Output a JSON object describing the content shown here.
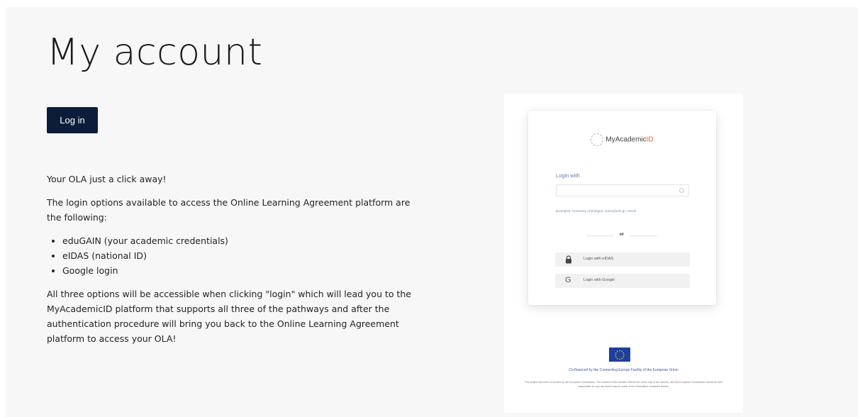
{
  "page": {
    "title": "My account",
    "login_button": "Log in"
  },
  "content": {
    "intro": "Your OLA just a click away!",
    "options_text": "The login options available to access the Online Learning Agreement platform are the following:",
    "options": [
      "eduGAIN (your academic credentials)",
      "eIDAS (national ID)",
      "Google login"
    ],
    "closing": "All three options will be accessible when clicking \"login\" which will lead you to the MyAcademicID platform that supports all three of the pathways and after the authentication procedure will bring you back to the Online Learning Agreement platform to access your OLA!"
  },
  "preview": {
    "brand_prefix": "My",
    "brand_main": "Academic",
    "brand_suffix": "ID",
    "login_with": "Login with",
    "example": "Examples: University of Bologna; name@edu.gr; Umich",
    "or": "or",
    "eidas_label": "Login with eIDAS",
    "google_label": "Login with Google",
    "eu_caption": "Co-financed by the Connecting Europe Facility of the European Union",
    "eu_disclaimer": "This project has been co-funded by the European Commission. The content of this website reflects the views only of the authors, and the European Commission cannot be held responsible for any use which may be made of the information contained therein."
  },
  "colors": {
    "primary_button": "#0b1d3a",
    "background": "#f7f7f8",
    "eu_blue": "#1f3f9f",
    "link_blue": "#5a7fb4"
  },
  "icons": [
    "lock-icon",
    "google-g-icon",
    "search-icon",
    "eu-flag-icon",
    "myacademicid-logo-icon"
  ]
}
